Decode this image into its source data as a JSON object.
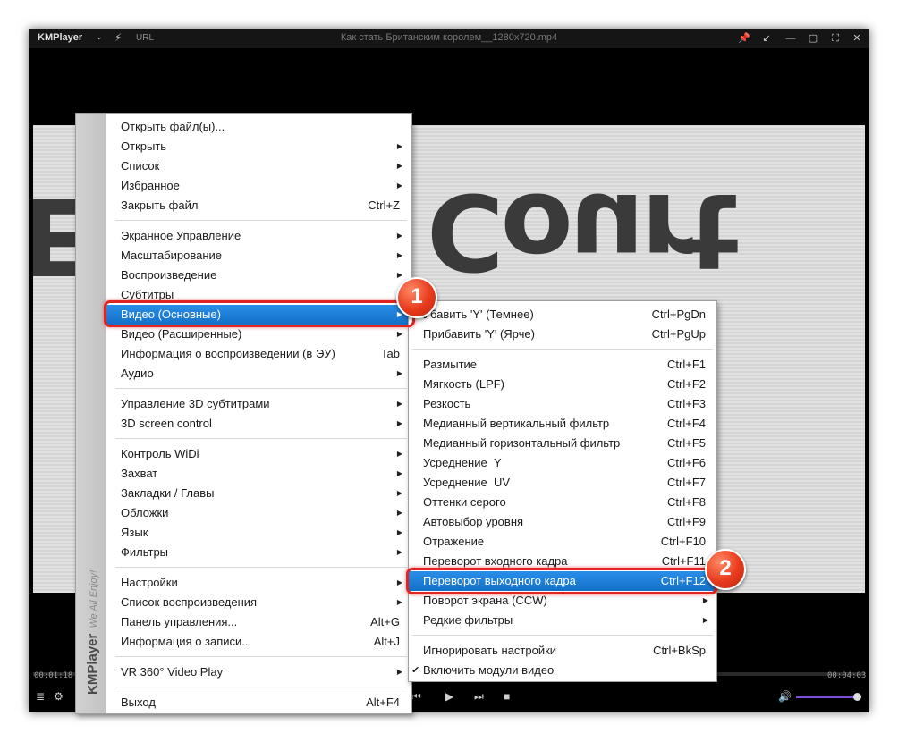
{
  "window": {
    "logo": "KMPlayer",
    "url_label": "URL",
    "title": "Как стать Британским королем__1280x720.mp4",
    "video_text_main": "Court",
    "video_text_edge": "E",
    "time_elapsed": "00:01:18",
    "time_total": "00:04:03",
    "volume_level": 0.9
  },
  "main_menu": {
    "brand": "KMPlayer",
    "tagline": "We All Enjoy!",
    "items": [
      {
        "label": "Открыть файл(ы)...",
        "shortcut": "",
        "arrow": false
      },
      {
        "label": "Открыть",
        "shortcut": "",
        "arrow": true
      },
      {
        "label": "Список",
        "shortcut": "",
        "arrow": true
      },
      {
        "label": "Избранное",
        "shortcut": "",
        "arrow": true
      },
      {
        "label": "Закрыть файл",
        "shortcut": "Ctrl+Z",
        "arrow": false
      },
      {
        "label": "Экранное Управление",
        "shortcut": "",
        "arrow": true
      },
      {
        "label": "Масштабирование",
        "shortcut": "",
        "arrow": true
      },
      {
        "label": "Воспроизведение",
        "shortcut": "",
        "arrow": true
      },
      {
        "label": "Субтитры",
        "shortcut": "",
        "arrow": true
      },
      {
        "label": "Видео (Основные)",
        "shortcut": "",
        "arrow": true
      },
      {
        "label": "Видео (Расширенные)",
        "shortcut": "",
        "arrow": true
      },
      {
        "label": "Информация о воспроизведении (в ЭУ)",
        "shortcut": "Tab",
        "arrow": false
      },
      {
        "label": "Аудио",
        "shortcut": "",
        "arrow": true
      },
      {
        "label": "Управление 3D субтитрами",
        "shortcut": "",
        "arrow": true
      },
      {
        "label": "3D screen control",
        "shortcut": "",
        "arrow": true
      },
      {
        "label": "Контроль WiDi",
        "shortcut": "",
        "arrow": true
      },
      {
        "label": "Захват",
        "shortcut": "",
        "arrow": true
      },
      {
        "label": "Закладки / Главы",
        "shortcut": "",
        "arrow": true
      },
      {
        "label": "Обложки",
        "shortcut": "",
        "arrow": true
      },
      {
        "label": "Язык",
        "shortcut": "",
        "arrow": true
      },
      {
        "label": "Фильтры",
        "shortcut": "",
        "arrow": true
      },
      {
        "label": "Настройки",
        "shortcut": "",
        "arrow": true
      },
      {
        "label": "Список воспроизведения",
        "shortcut": "",
        "arrow": true
      },
      {
        "label": "Панель управления...",
        "shortcut": "Alt+G",
        "arrow": false
      },
      {
        "label": "Информация о записи...",
        "shortcut": "Alt+J",
        "arrow": false
      },
      {
        "label": "VR 360° Video Play",
        "shortcut": "",
        "arrow": true
      },
      {
        "label": "Выход",
        "shortcut": "Alt+F4",
        "arrow": false
      }
    ]
  },
  "sub_menu": {
    "items": [
      {
        "label": "Убавить 'Y' (Темнее)",
        "shortcut": "Ctrl+PgDn",
        "arrow": false
      },
      {
        "label": "Прибавить 'Y' (Ярче)",
        "shortcut": "Ctrl+PgUp",
        "arrow": false
      },
      {
        "label": "Размытие",
        "shortcut": "Ctrl+F1",
        "arrow": false
      },
      {
        "label": "Мягкость (LPF)",
        "shortcut": "Ctrl+F2",
        "arrow": false
      },
      {
        "label": "Резкость",
        "shortcut": "Ctrl+F3",
        "arrow": false
      },
      {
        "label": "Медианный вертикальный фильтр",
        "shortcut": "Ctrl+F4",
        "arrow": false
      },
      {
        "label": "Медианный горизонтальный фильтр",
        "shortcut": "Ctrl+F5",
        "arrow": false
      },
      {
        "label": "Усреднение  Y",
        "shortcut": "Ctrl+F6",
        "arrow": false
      },
      {
        "label": "Усреднение  UV",
        "shortcut": "Ctrl+F7",
        "arrow": false
      },
      {
        "label": "Оттенки серого",
        "shortcut": "Ctrl+F8",
        "arrow": false
      },
      {
        "label": "Автовыбор уровня",
        "shortcut": "Ctrl+F9",
        "arrow": false
      },
      {
        "label": "Отражение",
        "shortcut": "Ctrl+F10",
        "arrow": false
      },
      {
        "label": "Переворот входного кадра",
        "shortcut": "Ctrl+F11",
        "arrow": false
      },
      {
        "label": "Переворот выходного кадра",
        "shortcut": "Ctrl+F12",
        "arrow": false
      },
      {
        "label": "Поворот экрана (CCW)",
        "shortcut": "",
        "arrow": true
      },
      {
        "label": "Редкие фильтры",
        "shortcut": "",
        "arrow": true
      },
      {
        "label": "Игнорировать настройки",
        "shortcut": "Ctrl+BkSp",
        "arrow": false
      },
      {
        "label": "Включить модули видео",
        "shortcut": "",
        "arrow": false,
        "check": "✔"
      }
    ]
  },
  "annotations": {
    "badge1": "1",
    "badge2": "2"
  }
}
